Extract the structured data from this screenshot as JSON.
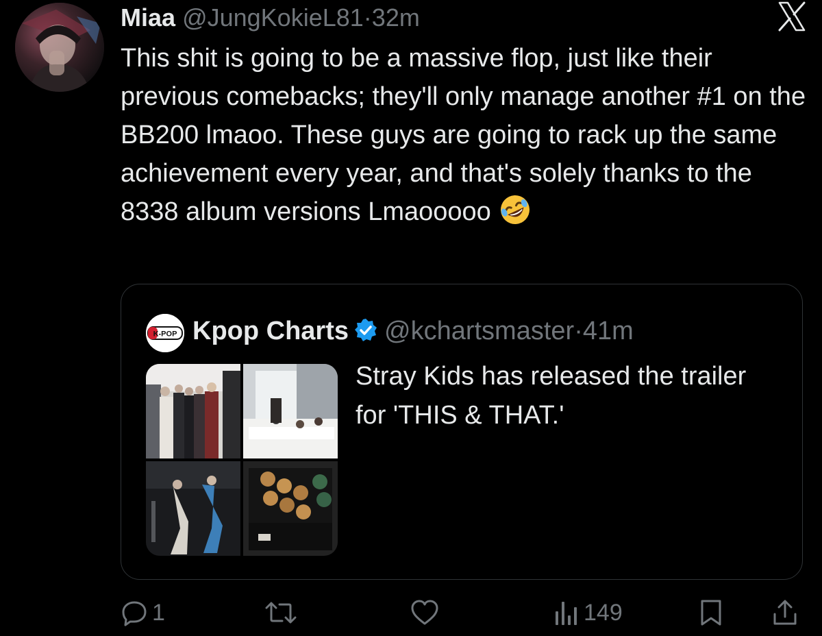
{
  "tweet": {
    "display_name": "Miaa",
    "handle": "@JungKokieL81",
    "separator": "·",
    "time": "32m",
    "text": "This shit is going to be a massive flop, just like their previous comebacks; they'll only manage another #1 on the BB200 lmaoo. These guys are going to rack up the same achievement every year, and that's solely thanks to the 8338 album versions Lmaooooo",
    "emoji": "rolling-on-the-floor-laughing",
    "header_icon": "x-logo"
  },
  "quoted": {
    "avatar_text": "K-POP",
    "display_name": "Kpop Charts",
    "handle": "@kchartsmaster",
    "separator": "·",
    "time": "41m",
    "text": "Stray Kids has released the trailer for 'THIS & THAT.'",
    "media_count": 4
  },
  "actions": {
    "reply_icon": "reply-icon",
    "reply_count": "1",
    "retweet_icon": "retweet-icon",
    "like_icon": "heart-icon",
    "views_icon": "views-icon",
    "views_count": "149",
    "bookmark_icon": "bookmark-icon",
    "share_icon": "share-icon"
  },
  "colors": {
    "background": "#000000",
    "text": "#e7e9ea",
    "muted": "#71767b",
    "border": "#2f3336",
    "verified": "#1d9bf0"
  }
}
